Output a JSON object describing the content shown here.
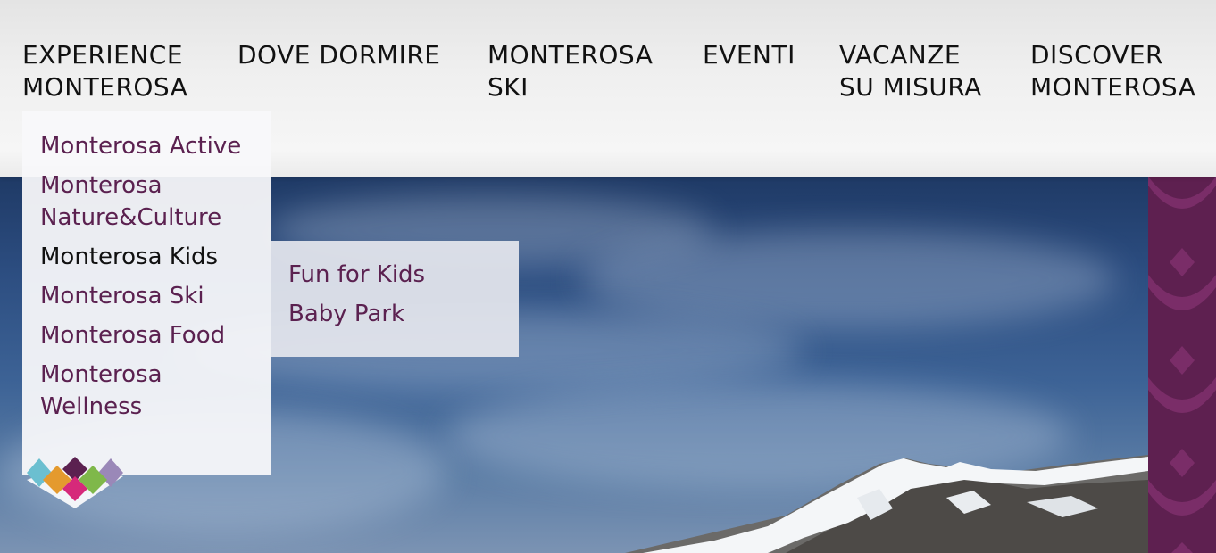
{
  "nav": {
    "items": [
      {
        "label": "EXPERIENCE\nMONTEROSA"
      },
      {
        "label": "DOVE DORMIRE"
      },
      {
        "label": "MONTEROSA\nSKI"
      },
      {
        "label": "EVENTI"
      },
      {
        "label": "VACANZE\nSU MISURA"
      },
      {
        "label": "DISCOVER\nMONTEROSA"
      }
    ]
  },
  "dropdown": {
    "items": [
      {
        "label": "Monterosa Active"
      },
      {
        "label": "Monterosa\nNature&Culture"
      },
      {
        "label": "Monterosa Kids"
      },
      {
        "label": "Monterosa Ski"
      },
      {
        "label": "Monterosa Food"
      },
      {
        "label": "Monterosa\nWellness"
      }
    ]
  },
  "submenu": {
    "items": [
      {
        "label": "Fun for Kids"
      },
      {
        "label": "Baby Park"
      }
    ]
  },
  "colors": {
    "menu_text": "#5b2150",
    "active_text": "#111111",
    "strip": "#5e2050"
  },
  "icons": [
    "monterosa-logo-icon"
  ]
}
